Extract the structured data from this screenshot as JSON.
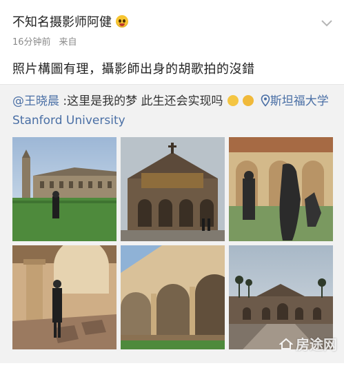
{
  "post": {
    "username": "不知名摄影师阿健",
    "time": "16分钟前",
    "source": "来自",
    "content": "照片構圖有理，攝影師出身的胡歌拍的沒錯"
  },
  "repost": {
    "mention": "@王晓晨",
    "text": " :这里是我的梦 此生还会实现吗",
    "location": "斯坦福大学 Stanford University"
  },
  "photos": [
    {
      "desc": "stanford-tower-lawn"
    },
    {
      "desc": "memorial-church"
    },
    {
      "desc": "rodin-sculptures"
    },
    {
      "desc": "arcade-corridor-person"
    },
    {
      "desc": "sandstone-arches"
    },
    {
      "desc": "main-quad-view"
    }
  ],
  "watermark": {
    "text": "房途网"
  },
  "colors": {
    "link": "#4a6fa5",
    "meta": "#8a8a8a",
    "repost_bg": "#f2f2f2"
  }
}
